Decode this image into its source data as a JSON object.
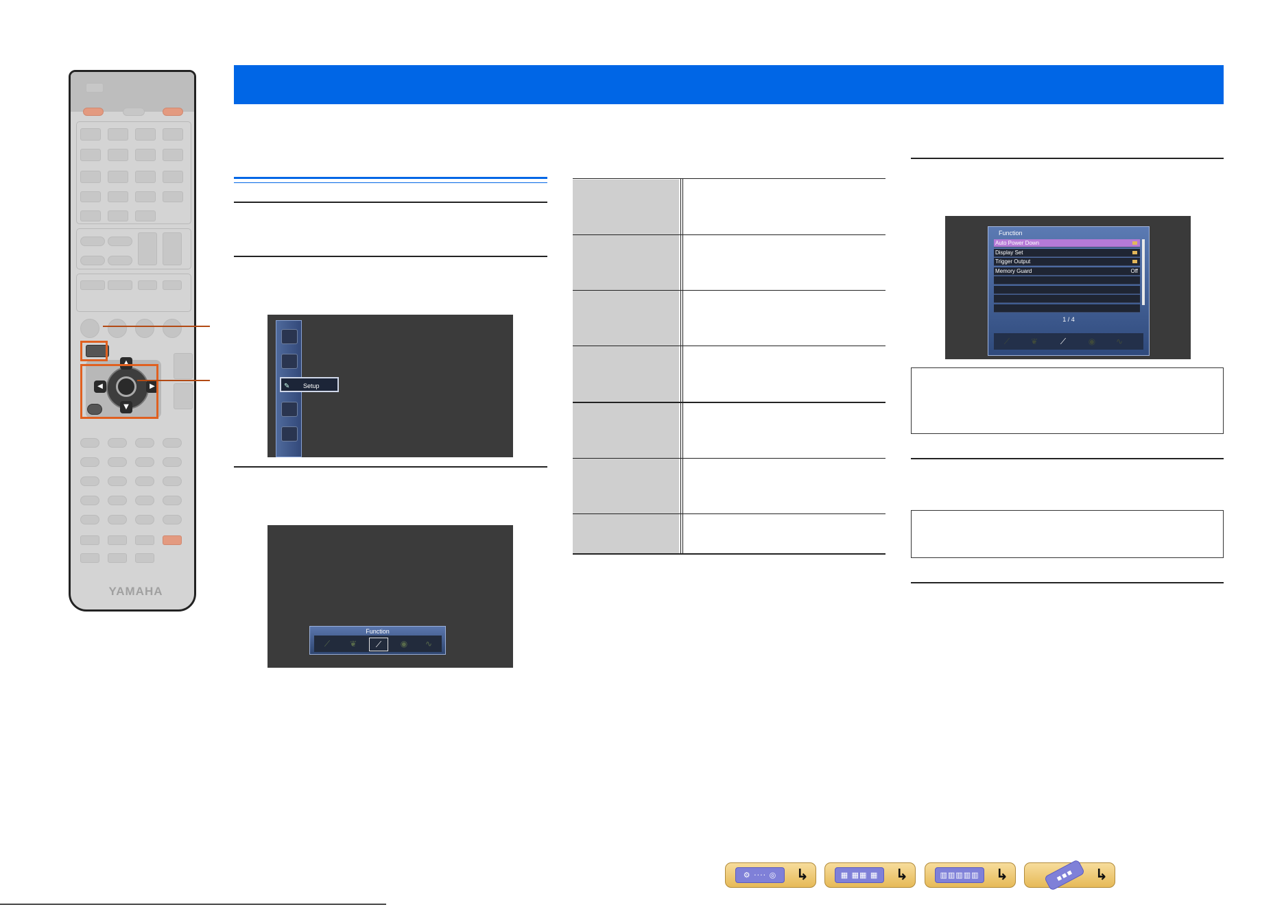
{
  "remote": {
    "brand": "YAMAHA",
    "dpad_arrows": {
      "up": "▲",
      "down": "▼",
      "left": "◀",
      "right": "▶"
    }
  },
  "screens": {
    "setup_menu": {
      "label": "Setup"
    },
    "function_bar": {
      "title": "Function",
      "icons": [
        "speaker-icon",
        "leaf-icon",
        "wrench-icon",
        "abc-icon",
        "waveform-icon"
      ]
    },
    "function_menu": {
      "title": "Function",
      "items": [
        {
          "label": "Auto Power Down",
          "value": "",
          "folder": true,
          "selected": true
        },
        {
          "label": "Display Set",
          "value": "",
          "folder": true,
          "selected": false
        },
        {
          "label": "Trigger Output",
          "value": "",
          "folder": true,
          "selected": false
        },
        {
          "label": "Memory Guard",
          "value": "Off",
          "folder": false,
          "selected": false
        },
        {
          "label": "",
          "value": "",
          "folder": false,
          "selected": false
        },
        {
          "label": "",
          "value": "",
          "folder": false,
          "selected": false
        },
        {
          "label": "",
          "value": "",
          "folder": false,
          "selected": false
        },
        {
          "label": "",
          "value": "",
          "folder": false,
          "selected": false
        }
      ],
      "page": "1 / 4"
    }
  },
  "colors": {
    "accent_blue": "#0066e6",
    "nav_gold": "#e6ba58",
    "highlight_orange": "#e06020"
  },
  "nav_buttons": [
    "front-panel-icon",
    "rear-panel-icon",
    "display-icon",
    "remote-icon"
  ]
}
